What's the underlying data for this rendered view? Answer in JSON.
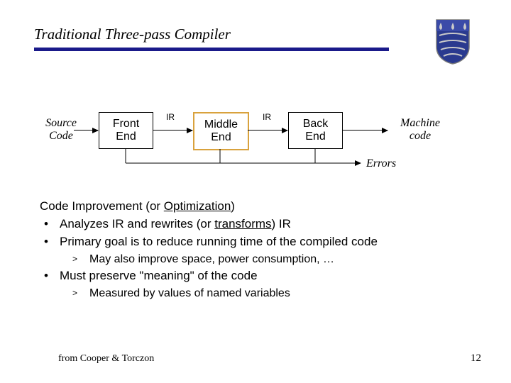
{
  "title": "Traditional Three-pass Compiler",
  "logo": {
    "name": "shield-crest-icon",
    "fill": "#2a3a8f",
    "stroke": "#7a7a7a"
  },
  "diagram": {
    "source_label": "Source\nCode",
    "front_label": "Front\nEnd",
    "middle_label": "Middle\nEnd",
    "back_label": "Back\nEnd",
    "machine_label": "Machine\ncode",
    "ir1_label": "IR",
    "ir2_label": "IR",
    "errors_label": "Errors"
  },
  "body": {
    "heading_pre": "Code Improvement (or ",
    "heading_u": "Optimization",
    "heading_post": ")",
    "b1_pre": "Analyzes IR and rewrites (or ",
    "b1_u": "transforms",
    "b1_post": ") IR",
    "b2": "Primary goal is to reduce running time of the compiled code",
    "b2_sub": "May also improve space, power consumption, …",
    "b3": "Must preserve \"meaning\" of the code",
    "b3_sub": "Measured by values of named variables"
  },
  "footer": {
    "left": "from Cooper & Torczon",
    "right": "12"
  }
}
